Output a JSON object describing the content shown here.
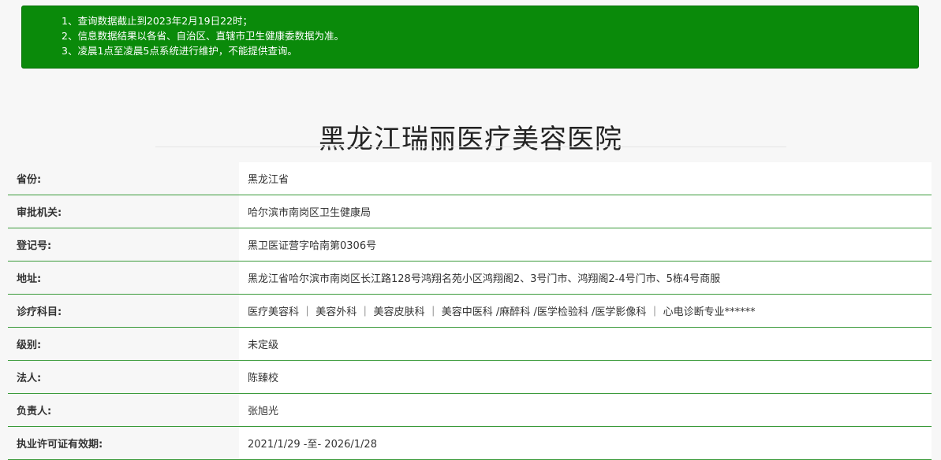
{
  "notice": {
    "items": [
      "1、查询数据截止到2023年2月19日22时；",
      "2、信息数据结果以各省、自治区、直辖市卫生健康委数据为准。",
      "3、凌晨1点至凌晨5点系统进行维护，不能提供查询。"
    ]
  },
  "title": "黑龙江瑞丽医疗美容医院",
  "rows": [
    {
      "label": "省份:",
      "value": "黑龙江省"
    },
    {
      "label": "审批机关:",
      "value": "哈尔滨市南岗区卫生健康局"
    },
    {
      "label": "登记号:",
      "value": "黑卫医证营字哈南第0306号"
    },
    {
      "label": "地址:",
      "value": "黑龙江省哈尔滨市南岗区长江路128号鸿翔名苑小区鸿翔阁2、3号门市、鸿翔阁2-4号门市、5栋4号商服"
    },
    {
      "label": "诊疗科目:",
      "value": "医疗美容科 ｜ 美容外科 ｜ 美容皮肤科 ｜ 美容中医科 /麻醉科 /医学检验科 /医学影像科 ｜ 心电诊断专业******"
    },
    {
      "label": "级别:",
      "value": "未定级"
    },
    {
      "label": "法人:",
      "value": "陈臻校"
    },
    {
      "label": "负责人:",
      "value": "张旭光"
    },
    {
      "label": "执业许可证有效期:",
      "value": "2021/1/29 -至- 2026/1/28"
    }
  ]
}
